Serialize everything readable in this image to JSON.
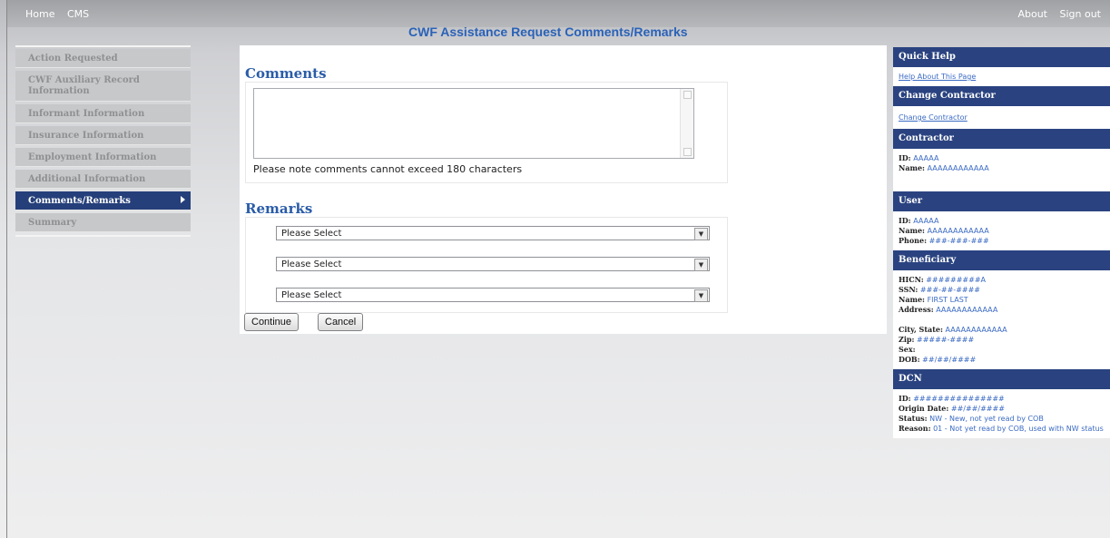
{
  "top_nav": {
    "home": "Home",
    "cms": "CMS",
    "about": "About",
    "sign_out": "Sign out"
  },
  "page_title": "CWF Assistance Request Comments/Remarks",
  "left_nav": [
    {
      "label": "Action Requested",
      "active": false
    },
    {
      "label": "CWF Auxiliary Record Information",
      "active": false
    },
    {
      "label": "Informant Information",
      "active": false
    },
    {
      "label": "Insurance Information",
      "active": false
    },
    {
      "label": "Employment Information",
      "active": false
    },
    {
      "label": "Additional Information",
      "active": false
    },
    {
      "label": "Comments/Remarks",
      "active": true
    },
    {
      "label": "Summary",
      "active": false
    }
  ],
  "comments": {
    "heading": "Comments",
    "value": "",
    "note": "Please note comments cannot exceed 180 characters"
  },
  "remarks": {
    "heading": "Remarks",
    "selects": [
      "Please Select",
      "Please Select",
      "Please Select"
    ]
  },
  "buttons": {
    "continue": "Continue",
    "cancel": "Cancel"
  },
  "quick_help": {
    "heading": "Quick Help",
    "link": "Help About This Page"
  },
  "change_contractor": {
    "heading": "Change Contractor",
    "link": "Change Contractor"
  },
  "contractor": {
    "heading": "Contractor",
    "id_label": "ID:",
    "id": "AAAAA",
    "name_label": "Name:",
    "name": "AAAAAAAAAAAA"
  },
  "user": {
    "heading": "User",
    "id_label": "ID:",
    "id": "AAAAA",
    "name_label": "Name:",
    "name": "AAAAAAAAAAAA",
    "phone_label": "Phone:",
    "phone": "###-###-###"
  },
  "beneficiary": {
    "heading": "Beneficiary",
    "hicn_label": "HICN:",
    "hicn": "#########A",
    "ssn_label": "SSN:",
    "ssn": "###-##-####",
    "name_label": "Name:",
    "name": "FIRST LAST",
    "address_label": "Address:",
    "address": "AAAAAAAAAAAA",
    "city_label": "City, State:",
    "city": "AAAAAAAAAAAA",
    "zip_label": "Zip:",
    "zip": "#####-####",
    "sex_label": "Sex:",
    "sex": "",
    "dob_label": "DOB:",
    "dob": "##/##/####"
  },
  "dcn": {
    "heading": "DCN",
    "id_label": "ID:",
    "id": "###############",
    "origin_label": "Origin Date:",
    "origin": "##/##/####",
    "status_label": "Status:",
    "status": "NW - New, not yet read by COB",
    "reason_label": "Reason:",
    "reason": "01 - Not yet read by COB, used with NW status"
  }
}
